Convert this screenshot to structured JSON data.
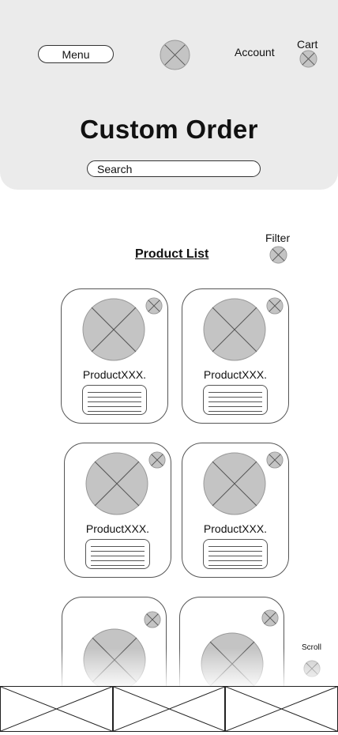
{
  "header": {
    "menu_label": "Menu",
    "logo_icon": "image-placeholder-icon",
    "account_label": "Account",
    "cart_label": "Cart",
    "title": "Custom Order",
    "search_placeholder": "Search"
  },
  "content": {
    "product_list_label": "Product List",
    "filter_label": "Filter",
    "scroll_label": "Scroll"
  },
  "products": [
    {
      "name": "ProductXXX."
    },
    {
      "name": "ProductXXX."
    },
    {
      "name": "ProductXXX."
    },
    {
      "name": "ProductXXX."
    },
    {
      "name": ""
    },
    {
      "name": ""
    }
  ],
  "footer": {
    "tabs": [
      "tab-1",
      "tab-2",
      "tab-3"
    ]
  },
  "colors": {
    "header_bg": "#ebebeb",
    "placeholder": "#c4c4c4",
    "border": "#555555"
  }
}
